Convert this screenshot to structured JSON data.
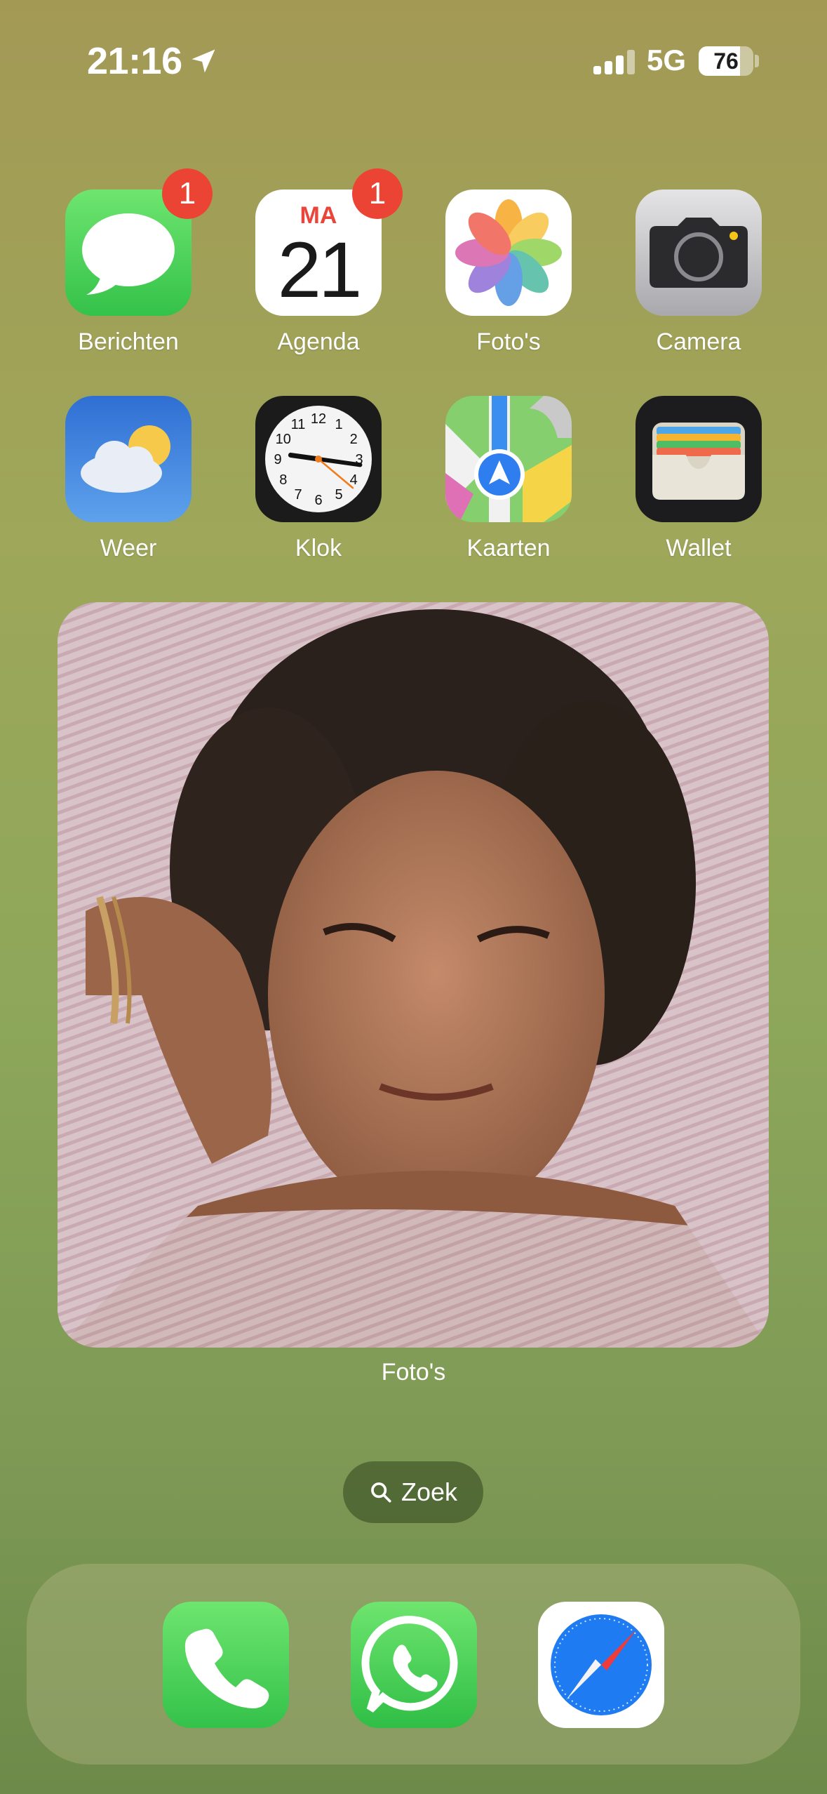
{
  "status_bar": {
    "time": "21:16",
    "network": "5G",
    "battery_percent": "76",
    "battery_level": 0.76,
    "signal_bars_active": 3,
    "signal_bars_total": 4
  },
  "apps": [
    {
      "label": "Berichten",
      "icon": "messages-icon",
      "badge": "1"
    },
    {
      "label": "Agenda",
      "icon": "calendar-icon",
      "badge": "1",
      "calendar_day": "MA",
      "calendar_date": "21"
    },
    {
      "label": "Foto's",
      "icon": "photos-icon"
    },
    {
      "label": "Camera",
      "icon": "camera-icon"
    },
    {
      "label": "Weer",
      "icon": "weather-icon"
    },
    {
      "label": "Klok",
      "icon": "clock-icon",
      "clock_numbers": [
        "12",
        "1",
        "2",
        "3",
        "4",
        "5",
        "6",
        "7",
        "8",
        "9",
        "10",
        "11"
      ]
    },
    {
      "label": "Kaarten",
      "icon": "maps-icon"
    },
    {
      "label": "Wallet",
      "icon": "wallet-icon"
    }
  ],
  "widget": {
    "label": "Foto's",
    "content": "photo-widget-image"
  },
  "search": {
    "label": "Zoek",
    "icon": "search-icon"
  },
  "dock": [
    {
      "icon": "phone-icon"
    },
    {
      "icon": "whatsapp-icon"
    },
    {
      "icon": "safari-icon"
    }
  ],
  "colors": {
    "badge": "#eb4434",
    "messages_green": "#4ecf5b",
    "safari_blue": "#1e7bf2"
  }
}
